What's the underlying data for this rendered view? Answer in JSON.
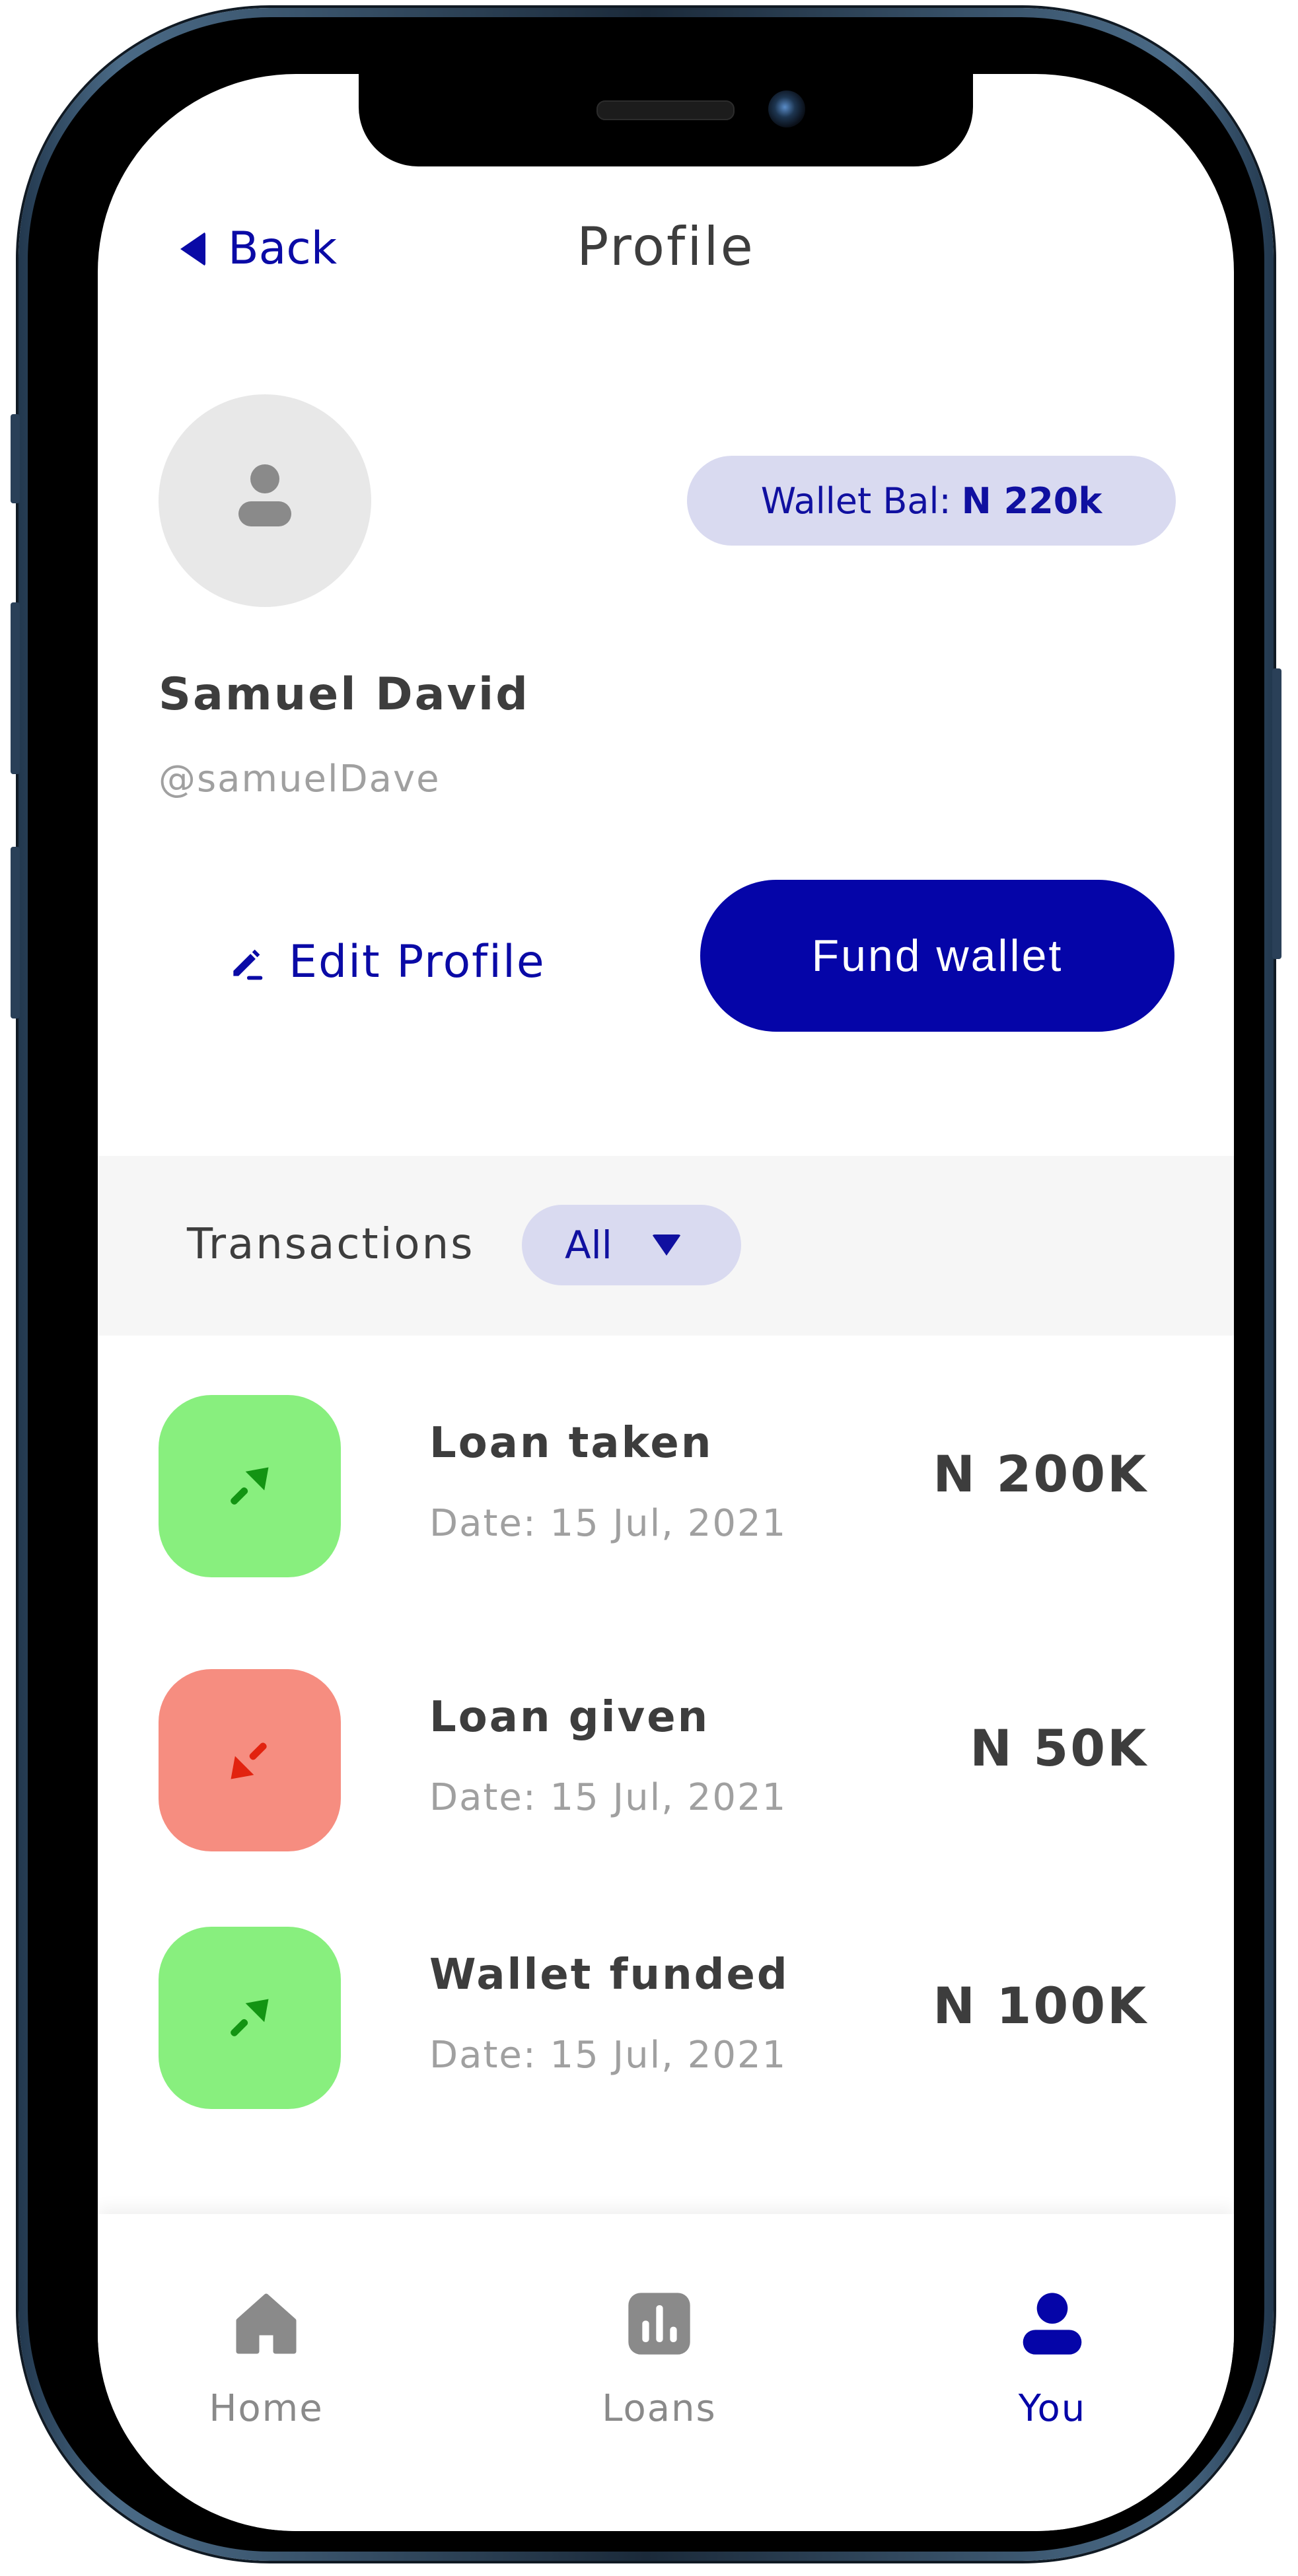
{
  "header": {
    "back_label": "Back",
    "title": "Profile"
  },
  "profile": {
    "wallet_label": "Wallet Bal:",
    "wallet_value": "N 220k",
    "name": "Samuel David",
    "handle": "@samuelDave",
    "edit_label": "Edit Profile",
    "fund_label": "Fund wallet"
  },
  "transactions": {
    "label": "Transactions",
    "filter_value": "All",
    "items": [
      {
        "title": "Loan taken",
        "date": "Date: 15 Jul, 2021",
        "amount": "N 200K",
        "direction": "in",
        "color": "#88ef7e"
      },
      {
        "title": "Loan given",
        "date": "Date: 15 Jul, 2021",
        "amount": "N 50K",
        "direction": "out",
        "color": "#f68d80"
      },
      {
        "title": "Wallet funded",
        "date": "Date: 15 Jul, 2021",
        "amount": "N 100K",
        "direction": "in",
        "color": "#88ef7e"
      }
    ]
  },
  "nav": {
    "items": [
      {
        "label": "Home",
        "icon": "home-icon",
        "active": false
      },
      {
        "label": "Loans",
        "icon": "chart-icon",
        "active": false
      },
      {
        "label": "You",
        "icon": "user-icon",
        "active": true
      }
    ]
  },
  "colors": {
    "accent": "#0505a8",
    "accent_soft": "#d9daf0",
    "income": "#88ef7e",
    "expense": "#f68d80",
    "text": "#3d3d3d",
    "muted": "#a0a0a0"
  }
}
